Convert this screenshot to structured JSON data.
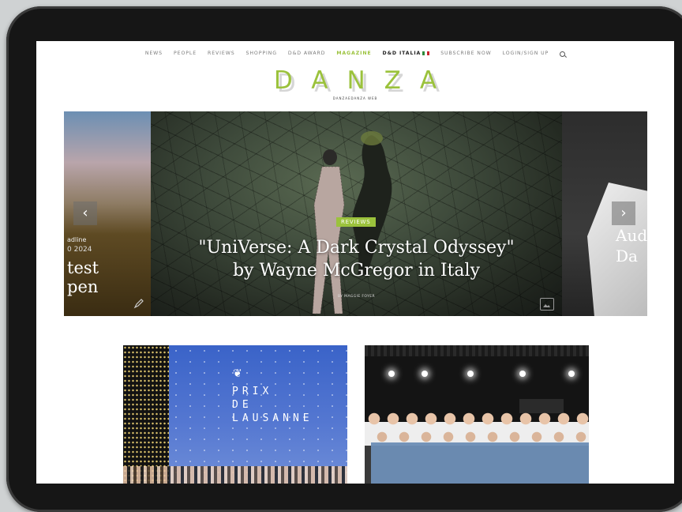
{
  "nav": {
    "items": [
      "NEWS",
      "PEOPLE",
      "REVIEWS",
      "SHOPPING",
      "D&D AWARD",
      "MAGAZINE",
      "D&D ITALIA",
      "SUBSCRIBE NOW",
      "LOGIN/SIGN UP"
    ],
    "accent": "#9bc23c"
  },
  "logo": {
    "text": "DANZA",
    "subtitle": "DANZAEDANZA WEB"
  },
  "slider": {
    "left_slide": {
      "small": "adline",
      "small2": "0 2024",
      "text": "test\npen"
    },
    "main_slide": {
      "category": "REVIEWS",
      "headline_line1": "\"UniVerse: A Dark Crystal Odyssey\"",
      "headline_line2": "by Wayne McGregor in Italy",
      "byline": "BY MAGGIE FOYER"
    },
    "right_slide": {
      "text": "Aud\nDa"
    },
    "prev_arrow": "‹",
    "next_arrow": "›"
  },
  "cards": [
    {
      "title": "PRIX\nDE\nLAUSANNE"
    },
    {
      "title": ""
    }
  ]
}
